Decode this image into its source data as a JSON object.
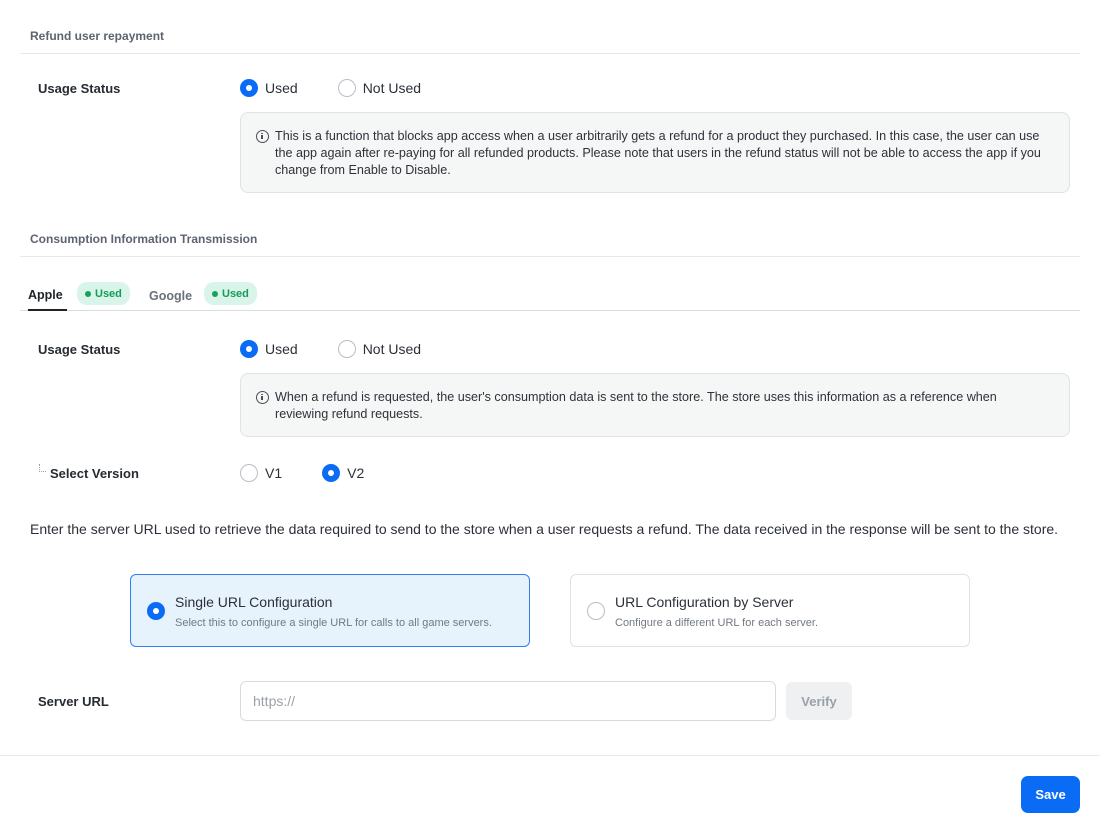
{
  "refund_section": {
    "title": "Refund user repayment",
    "usage_label": "Usage Status",
    "options": [
      "Used",
      "Not Used"
    ],
    "selected": "Used",
    "info": "This is a function that blocks app access when a user arbitrarily gets a refund for a product they purchased. In this case, the user can use the app again after re-paying for all refunded products. Please note that users in the refund status will not be able to access the app if you change from Enable to Disable."
  },
  "consumption_section": {
    "title": "Consumption Information Transmission",
    "tabs": [
      {
        "label": "Apple",
        "badge": "Used",
        "active": true
      },
      {
        "label": "Google",
        "badge": "Used",
        "active": false
      }
    ],
    "usage_label": "Usage Status",
    "options": [
      "Used",
      "Not Used"
    ],
    "selected": "Used",
    "info": "When a refund is requested, the user's consumption data is sent to the store. The store uses this information as a reference when reviewing refund requests.",
    "version_label": "Select Version",
    "versions": [
      "V1",
      "V2"
    ],
    "selected_version": "V2",
    "description": "Enter the server URL used to retrieve the data required to send to the store when a user requests a refund. The data received in the response will be sent to the store.",
    "config_options": [
      {
        "title": "Single URL Configuration",
        "subtitle": "Select this to configure a single URL for calls to all game servers.",
        "selected": true
      },
      {
        "title": "URL Configuration by Server",
        "subtitle": "Configure a different URL for each server.",
        "selected": false
      }
    ],
    "server_url_label": "Server URL",
    "server_url_placeholder": "https://",
    "server_url_value": "",
    "verify_label": "Verify"
  },
  "footer": {
    "save_label": "Save"
  },
  "colors": {
    "accent": "#0a6cf5",
    "badge_bg": "#d9f4e8",
    "badge_text": "#149c5a",
    "selected_card_bg": "#e6f2fc"
  }
}
